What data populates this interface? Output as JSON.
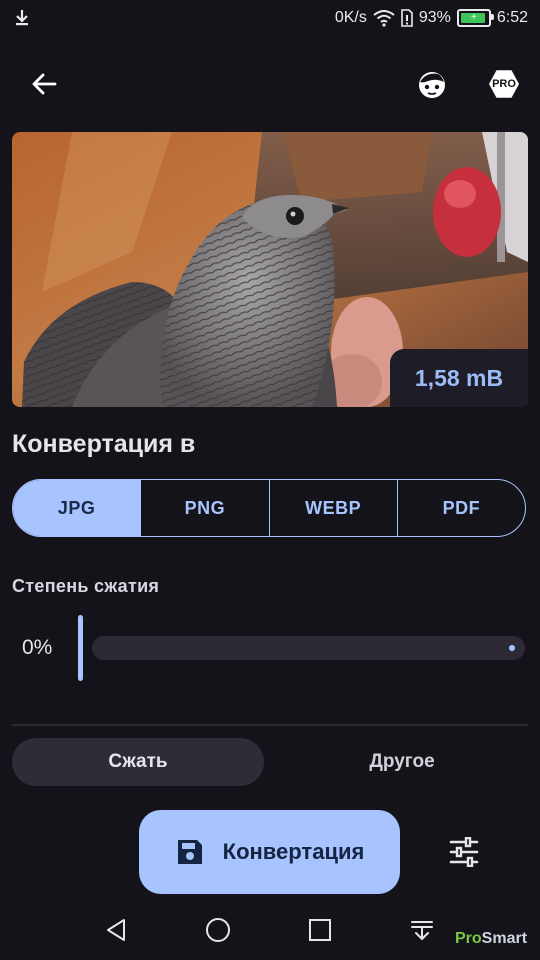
{
  "status_bar": {
    "net_speed": "0K/s",
    "battery": "93%",
    "time": "6:52",
    "battery_color": "#3cc55a"
  },
  "top_bar": {
    "back_icon": "arrow-left-icon",
    "face_icon": "face-icon",
    "pro_label": "PRO"
  },
  "preview": {
    "file_size": "1,58 mB"
  },
  "convert_section": {
    "title": "Конвертация в",
    "formats": [
      "JPG",
      "PNG",
      "WEBP",
      "PDF"
    ],
    "selected_format": "JPG"
  },
  "compression": {
    "label": "Степень сжатия",
    "value": "0%",
    "level": 0
  },
  "tabs": {
    "compress": "Сжать",
    "other": "Другое",
    "active": "compress"
  },
  "actions": {
    "convert_label": "Конвертация"
  },
  "watermark": {
    "part1": "Pro",
    "part2": "Smart"
  },
  "colors": {
    "accent": "#a7c4ff",
    "background": "#15131a",
    "surface": "#2e2c37"
  }
}
